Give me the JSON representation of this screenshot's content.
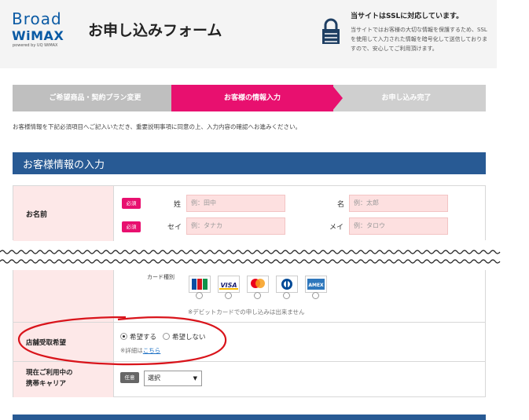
{
  "header": {
    "logo_line1": "Broad",
    "logo_line2": "WiMAX",
    "logo_powered": "powered by UQ WiMAX",
    "title": "お申し込みフォーム",
    "ssl_title": "当サイトはSSLに対応しています。",
    "ssl_desc": "当サイトではお客様の大切な情報を保護するため、SSLを使用して入力された情報を暗号化して送信しておりますので、安心してご利用頂けます。"
  },
  "steps": [
    "ご希望商品・契約プラン変更",
    "お客様の情報入力",
    "お申し込み完了"
  ],
  "notice": "お客様情報を下記必須項目へご記入いただき、重要説明事項に同意の上、入力内容の確認へお進みください。",
  "section_title": "お客様情報の入力",
  "name_row": {
    "label": "お名前",
    "required": "必須",
    "sei_label": "姓",
    "sei_placeholder": "例：田中",
    "mei_label": "名",
    "mei_placeholder": "例：太郎",
    "sei_kana_label": "セイ",
    "sei_kana_placeholder": "例：タナカ",
    "mei_kana_label": "メイ",
    "mei_kana_placeholder": "例：タロウ"
  },
  "card_row": {
    "kind_label": "カード種別",
    "cards": [
      "JCB",
      "VISA",
      "MasterCard",
      "Diners",
      "AMEX"
    ],
    "debit_note": "※デビットカードでの申し込みは出来ません"
  },
  "store_row": {
    "label": "店舗受取希望",
    "option_yes": "希望する",
    "option_no": "希望しない",
    "detail_prefix": "※詳細は",
    "detail_link": "こちら",
    "selected": "希望する"
  },
  "carrier_row": {
    "label_line1": "現在ご利用中の",
    "label_line2": "携帯キャリア",
    "optional": "任意",
    "select_value": "選択"
  },
  "colors": {
    "brand_blue": "#285a94",
    "accent_pink": "#e8106f",
    "annotation_red": "#d9141b"
  }
}
